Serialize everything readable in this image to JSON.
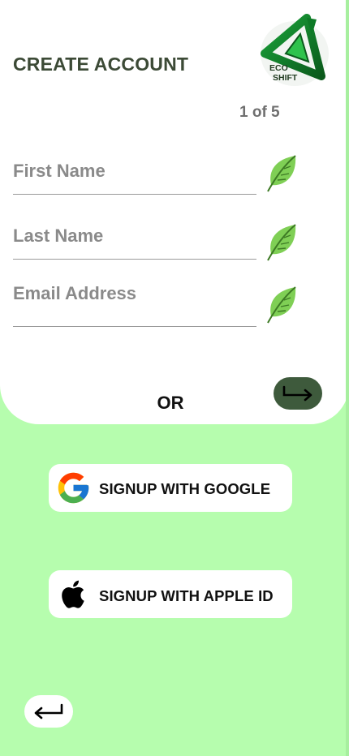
{
  "header": {
    "title": "CREATE ACCOUNT",
    "logo": {
      "line1": "ECO",
      "line2": "SHIFT",
      "icon": "eco-shift-triangle-logo"
    },
    "step_indicator": "1 of 5"
  },
  "form": {
    "fields": [
      {
        "name": "first-name",
        "placeholder": "First Name",
        "value": "",
        "icon": "leaf-icon"
      },
      {
        "name": "last-name",
        "placeholder": "Last Name",
        "value": "",
        "icon": "leaf-icon"
      },
      {
        "name": "email",
        "placeholder": "Email Address",
        "value": "",
        "icon": "leaf-icon"
      }
    ],
    "separator": "OR",
    "next_icon": "arrow-right-return-icon"
  },
  "social": {
    "google_label": "SIGNUP WITH GOOGLE",
    "apple_label": "SIGNUP WITH APPLE ID"
  },
  "nav": {
    "back_icon": "arrow-left-return-icon"
  },
  "colors": {
    "background": "#b6fdae",
    "card": "#ffffff",
    "accent_dark": "#3e5a3c",
    "leaf": "#7fcf55"
  }
}
